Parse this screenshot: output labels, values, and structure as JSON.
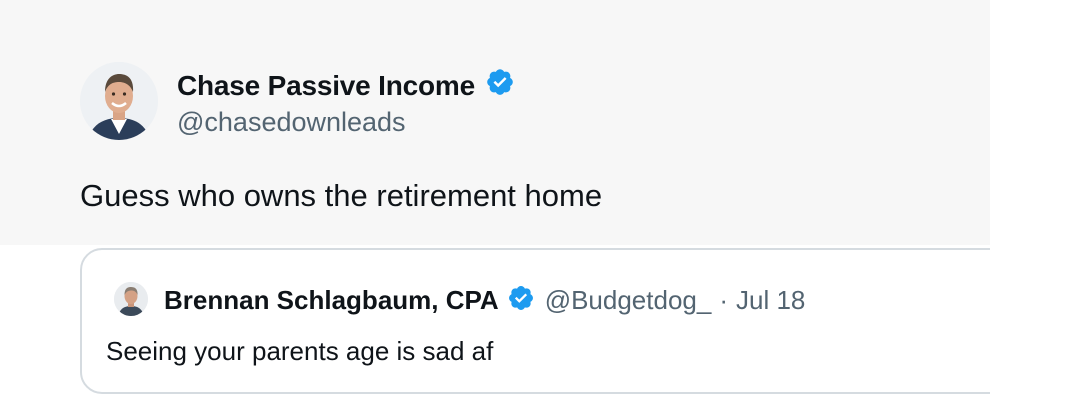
{
  "tweet": {
    "author": {
      "name": "Chase Passive Income",
      "handle": "@chasedownleads",
      "verified": true
    },
    "text": "Guess who owns the retirement home",
    "quoted": {
      "author": {
        "name": "Brennan Schlagbaum, CPA",
        "handle": "@Budgetdog_",
        "verified": true
      },
      "separator": "·",
      "date": "Jul 18",
      "text": "Seeing your parents age is sad af"
    }
  },
  "colors": {
    "verified_badge": "#1d9bf0",
    "primary_text": "#0f1419",
    "secondary_text": "#536471",
    "quote_border": "#d5dbe0"
  },
  "icons": {
    "verified": "verified-badge-icon"
  }
}
